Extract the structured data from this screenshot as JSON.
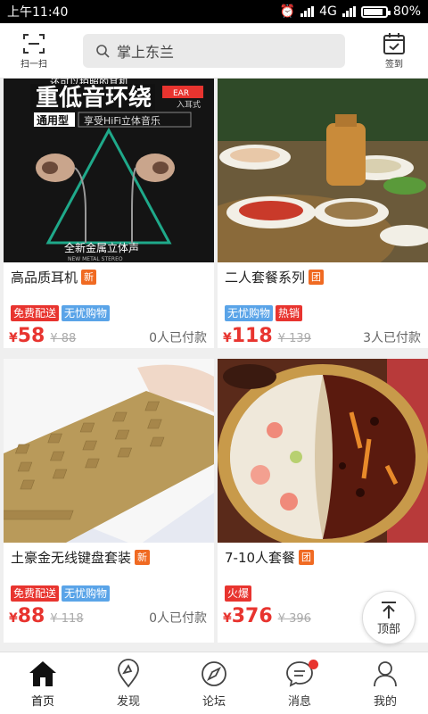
{
  "status": {
    "time": "上午11:40",
    "network": "4G",
    "battery": "80%"
  },
  "header": {
    "scan_label": "扫一扫",
    "search_text": "掌上东兰",
    "checkin_label": "签到"
  },
  "products": [
    {
      "title": "高品质耳机",
      "tag": "新",
      "badges": [
        {
          "text": "免费配送",
          "color": "#e8342f"
        },
        {
          "text": "无忧购物",
          "color": "#5aa4e8"
        }
      ],
      "currency": "¥",
      "price": "58",
      "old_price": "¥ 88",
      "paid": "0人已付款",
      "ad_lines": [
        "还可以拍照的耳机",
        "重低音环绕",
        "通用型",
        "享受HiFi立体音乐",
        "EAR",
        "入耳式",
        "全新金属立体声",
        "NEW METAL STEREO"
      ]
    },
    {
      "title": "二人套餐系列",
      "tag": "团",
      "badges": [
        {
          "text": "无忧购物",
          "color": "#5aa4e8"
        },
        {
          "text": "热销",
          "color": "#e8342f"
        }
      ],
      "currency": "¥",
      "price": "118",
      "old_price": "¥ 139",
      "paid": "3人已付款"
    },
    {
      "title": "土豪金无线键盘套装",
      "tag": "新",
      "badges": [
        {
          "text": "免费配送",
          "color": "#e8342f"
        },
        {
          "text": "无忧购物",
          "color": "#5aa4e8"
        }
      ],
      "currency": "¥",
      "price": "88",
      "old_price": "¥ 118",
      "paid": "0人已付款"
    },
    {
      "title": "7-10人套餐",
      "tag": "团",
      "badges": [
        {
          "text": "火爆",
          "color": "#e8342f"
        }
      ],
      "currency": "¥",
      "price": "376",
      "old_price": "¥ 396",
      "paid": ""
    }
  ],
  "back_to_top": "顶部",
  "nav": [
    {
      "label": "首页",
      "icon": "home-icon"
    },
    {
      "label": "发现",
      "icon": "discover-icon"
    },
    {
      "label": "论坛",
      "icon": "forum-icon"
    },
    {
      "label": "消息",
      "icon": "message-icon"
    },
    {
      "label": "我的",
      "icon": "profile-icon"
    }
  ]
}
